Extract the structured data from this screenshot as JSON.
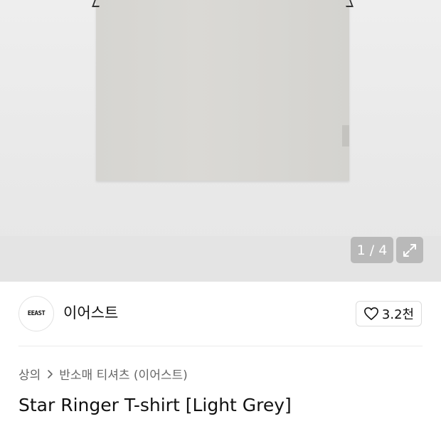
{
  "gallery": {
    "image_alt": "Star Ringer T-shirt Light Grey product photo",
    "counter": "1 / 4",
    "expand_icon": "expand-icon"
  },
  "brand": {
    "logo_text": "EEAST",
    "name": "이어스트",
    "like_count": "3.2천",
    "like_icon": "heart-icon"
  },
  "breadcrumb": {
    "category": "상의",
    "separator_icon": "chevron-right-icon",
    "subcategory": "반소매 티셔츠 (이어스트)"
  },
  "product": {
    "title": "Star Ringer T-shirt [Light Grey]"
  }
}
